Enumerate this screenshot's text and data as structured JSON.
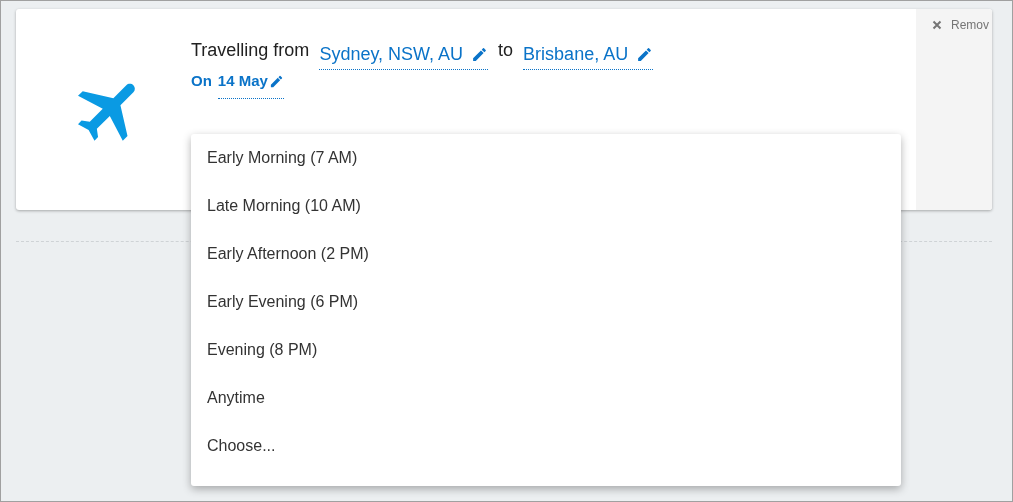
{
  "trip": {
    "prefix": "Travelling from",
    "origin": "Sydney, NSW, AU",
    "joiner": "to",
    "destination": "Brisbane, AU",
    "date_prefix": "On",
    "date": "14 May"
  },
  "remove_label": "Remov",
  "time_options": [
    {
      "label": "Early Morning (7 AM)"
    },
    {
      "label": "Late Morning (10 AM)"
    },
    {
      "label": "Early Afternoon (2 PM)"
    },
    {
      "label": "Early Evening (6 PM)"
    },
    {
      "label": "Evening (8 PM)"
    },
    {
      "label": "Anytime"
    },
    {
      "label": "Choose..."
    }
  ]
}
